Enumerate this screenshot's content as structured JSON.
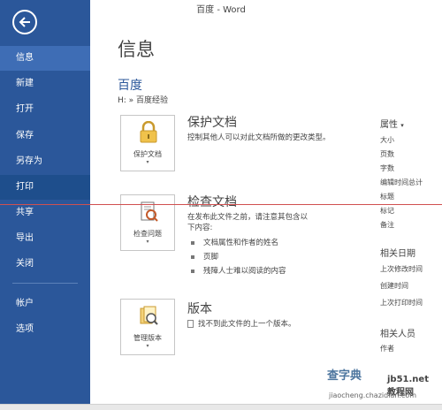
{
  "window": {
    "title": "百度 - Word"
  },
  "sidebar": {
    "items": [
      {
        "label": "信息"
      },
      {
        "label": "新建"
      },
      {
        "label": "打开"
      },
      {
        "label": "保存"
      },
      {
        "label": "另存为"
      },
      {
        "label": "打印"
      },
      {
        "label": "共享"
      },
      {
        "label": "导出"
      },
      {
        "label": "关闭"
      },
      {
        "label": "帐户"
      },
      {
        "label": "选项"
      }
    ]
  },
  "main": {
    "title": "信息",
    "doc_name": "百度",
    "doc_path": "H: » 百度经验",
    "sections": [
      {
        "button_label": "保护文档",
        "title": "保护文档",
        "description": "控制其他人可以对此文档所做的更改类型。",
        "icon": "lock-icon"
      },
      {
        "button_label": "检查问题",
        "title": "检查文档",
        "description_lines": [
          "在发布此文件之前，请注意其包含以",
          "下内容:"
        ],
        "bullets": [
          "文档属性和作者的姓名",
          "页脚",
          "残障人士难以阅读的内容"
        ],
        "icon": "inspect-document-icon"
      },
      {
        "button_label": "管理版本",
        "title": "版本",
        "description": "找不到此文件的上一个版本。",
        "icon": "versions-icon"
      }
    ]
  },
  "properties": {
    "header": "属性",
    "items": [
      "大小",
      "页数",
      "字数",
      "编辑时间总计",
      "标题",
      "标记",
      "备注"
    ],
    "dates_header": "相关日期",
    "dates": [
      "上次修改时间",
      "创建时间",
      "上次打印时间"
    ],
    "people_header": "相关人员",
    "people": [
      "作者"
    ]
  },
  "watermark": {
    "left": "查字典",
    "right": "教程网",
    "site": "jb51.net",
    "url": "jiaocheng.chazidian.com"
  },
  "colors": {
    "sidebar": "#2b579a",
    "accent": "#2b579a"
  }
}
